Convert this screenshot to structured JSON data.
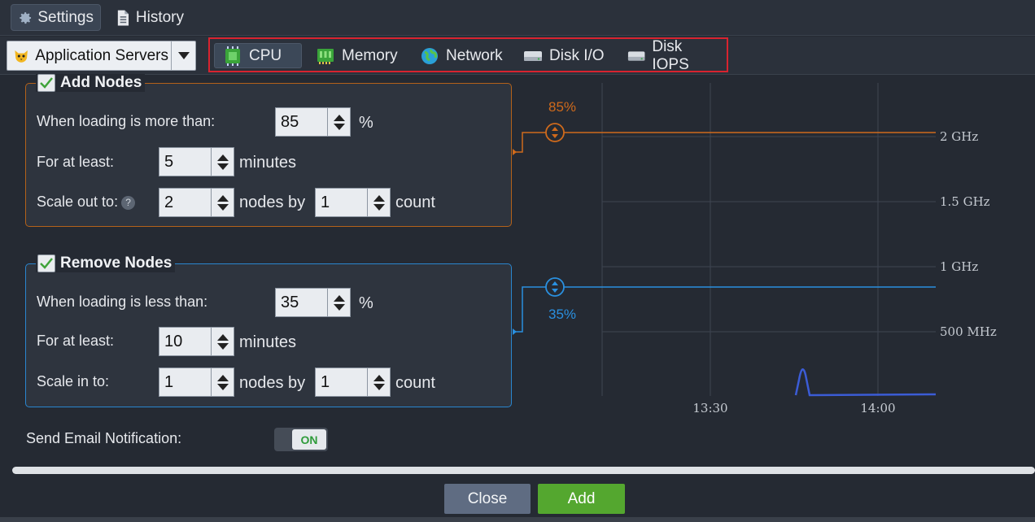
{
  "tabs": {
    "settings": "Settings",
    "history": "History"
  },
  "layer": {
    "selected": "Application Servers"
  },
  "metrics": [
    "CPU",
    "Memory",
    "Network",
    "Disk I/O",
    "Disk IOPS"
  ],
  "add_nodes": {
    "title": "Add Nodes",
    "checked": true,
    "when_label": "When loading is more than:",
    "when_value": "85",
    "percent": "%",
    "for_label": "For at least:",
    "for_value": "5",
    "minutes": "minutes",
    "scale_label": "Scale out to:",
    "scale_value": "2",
    "nodes_by": "nodes by",
    "by_value": "1",
    "count": "count"
  },
  "remove_nodes": {
    "title": "Remove Nodes",
    "checked": true,
    "when_label": "When loading is less than:",
    "when_value": "35",
    "percent": "%",
    "for_label": "For at least:",
    "for_value": "10",
    "minutes": "minutes",
    "scale_label": "Scale in to:",
    "scale_value": "1",
    "nodes_by": "nodes by",
    "by_value": "1",
    "count": "count"
  },
  "chart": {
    "upper_threshold": "85%",
    "lower_threshold": "35%",
    "y_labels": [
      "2 GHz",
      "1.5 GHz",
      "1 GHz",
      "500 MHz"
    ],
    "x_labels": [
      "13:30",
      "14:00"
    ],
    "colors": {
      "upper": "#cf6a1c",
      "lower": "#2a90e0",
      "line": "#3b5cd6"
    }
  },
  "email": {
    "label": "Send Email Notification:",
    "toggle": "ON"
  },
  "buttons": {
    "close": "Close",
    "add": "Add"
  }
}
